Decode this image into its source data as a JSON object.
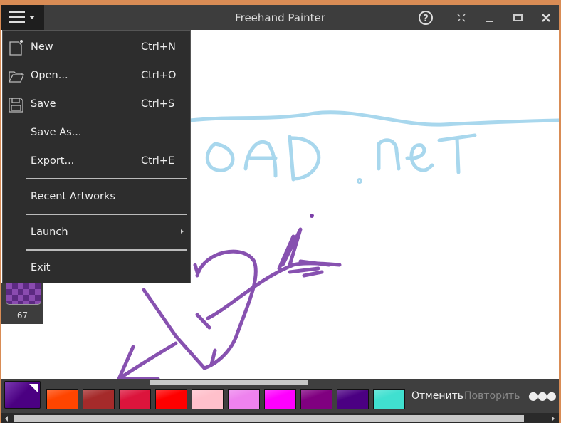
{
  "title": "Freehand Painter",
  "menu": {
    "items": [
      {
        "label": "New",
        "shortcut": "Ctrl+N",
        "icon": "new-file-icon"
      },
      {
        "label": "Open...",
        "shortcut": "Ctrl+O",
        "icon": "folder-open-icon"
      },
      {
        "label": "Save",
        "shortcut": "Ctrl+S",
        "icon": "floppy-save-icon"
      },
      {
        "label": "Save As..."
      },
      {
        "label": "Export...",
        "shortcut": "Ctrl+E"
      },
      {
        "label": "Recent Artworks"
      },
      {
        "label": "Launch"
      },
      {
        "label": "Exit"
      }
    ]
  },
  "brush": {
    "size": "67"
  },
  "palette": {
    "current": "#4b0082",
    "colors": [
      "#ff4500",
      "#a52a2a",
      "#dc143c",
      "#ff0000",
      "#ffc0cb",
      "#ee82ee",
      "#ff00ff",
      "#800080",
      "#4b0082",
      "#40e0d0"
    ]
  },
  "toolbar": {
    "undo": "Отменить",
    "redo": "Повторить",
    "more": "●●●"
  }
}
